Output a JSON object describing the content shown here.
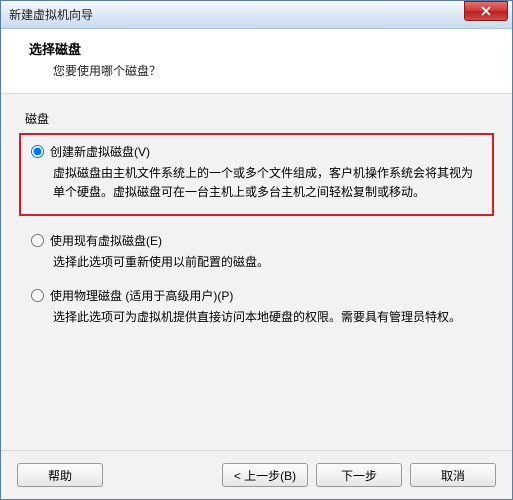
{
  "window": {
    "title": "新建虚拟机向导"
  },
  "header": {
    "title": "选择磁盘",
    "subtitle": "您要使用哪个磁盘？"
  },
  "section_label": "磁盘",
  "options": {
    "create": {
      "label": "创建新虚拟磁盘(V)",
      "desc": "虚拟磁盘由主机文件系统上的一个或多个文件组成，客户机操作系统会将其视为单个硬盘。虚拟磁盘可在一台主机上或多台主机之间轻松复制或移动。"
    },
    "existing": {
      "label": "使用现有虚拟磁盘(E)",
      "desc": "选择此选项可重新使用以前配置的磁盘。"
    },
    "physical": {
      "label": "使用物理磁盘 (适用于高级用户)(P)",
      "desc": "选择此选项可为虚拟机提供直接访问本地硬盘的权限。需要具有管理员特权。"
    }
  },
  "footer": {
    "help": "帮助",
    "back": "< 上一步(B)",
    "next": "下一步",
    "cancel": "取消"
  }
}
